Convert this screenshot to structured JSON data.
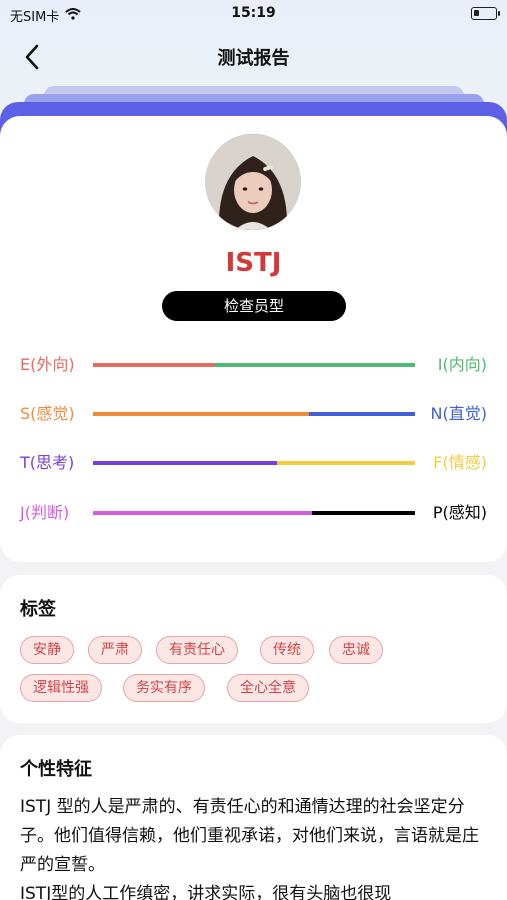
{
  "status": {
    "carrier": "无SIM卡",
    "time": "15:19"
  },
  "nav": {
    "title": "测试报告"
  },
  "profile": {
    "mbti": "ISTJ",
    "type_name": "检查员型"
  },
  "dimensions": [
    {
      "left": "E(外向)",
      "right": "I(内向)",
      "left_color": "#e8695e",
      "right_color": "#4fb873",
      "left_share": 0.38,
      "label_left_color": "#e8695e",
      "label_right_color": "#4fb873"
    },
    {
      "left": "S(感觉)",
      "right": "N(直觉)",
      "left_color": "#ee8c3c",
      "right_color": "#3f5fd8",
      "left_share": 0.67,
      "label_left_color": "#ee8c3c",
      "label_right_color": "#3f5fd8"
    },
    {
      "left": "T(思考)",
      "right": "F(情感)",
      "left_color": "#7a3fd8",
      "right_color": "#f1cc3f",
      "left_share": 0.57,
      "label_left_color": "#7a3fd8",
      "label_right_color": "#f1cc3f"
    },
    {
      "left": "J(判断)",
      "right": "P(感知)",
      "left_color": "#d35bdd",
      "right_color": "#000000",
      "left_share": 0.68,
      "label_left_color": "#d35bdd",
      "label_right_color": "#000000"
    }
  ],
  "tags": {
    "title": "标签",
    "items": [
      "安静",
      "严肃",
      "有责任心",
      "传统",
      "忠诚",
      "逻辑性强",
      "务实有序",
      "全心全意"
    ]
  },
  "traits": {
    "title": "个性特征",
    "paragraphs": [
      "ISTJ 型的人是严肃的、有责任心的和通情达理的社会坚定分子。他们值得信赖，他们重视承诺，对他们来说，言语就是庄严的宣誓。",
      "ISTJ型的人工作缜密，讲求实际，很有头脑也很现"
    ]
  },
  "colors": {
    "accent": "#5b60e6",
    "mbti_red": "#d23a3a",
    "tag_red": "#d04545"
  }
}
